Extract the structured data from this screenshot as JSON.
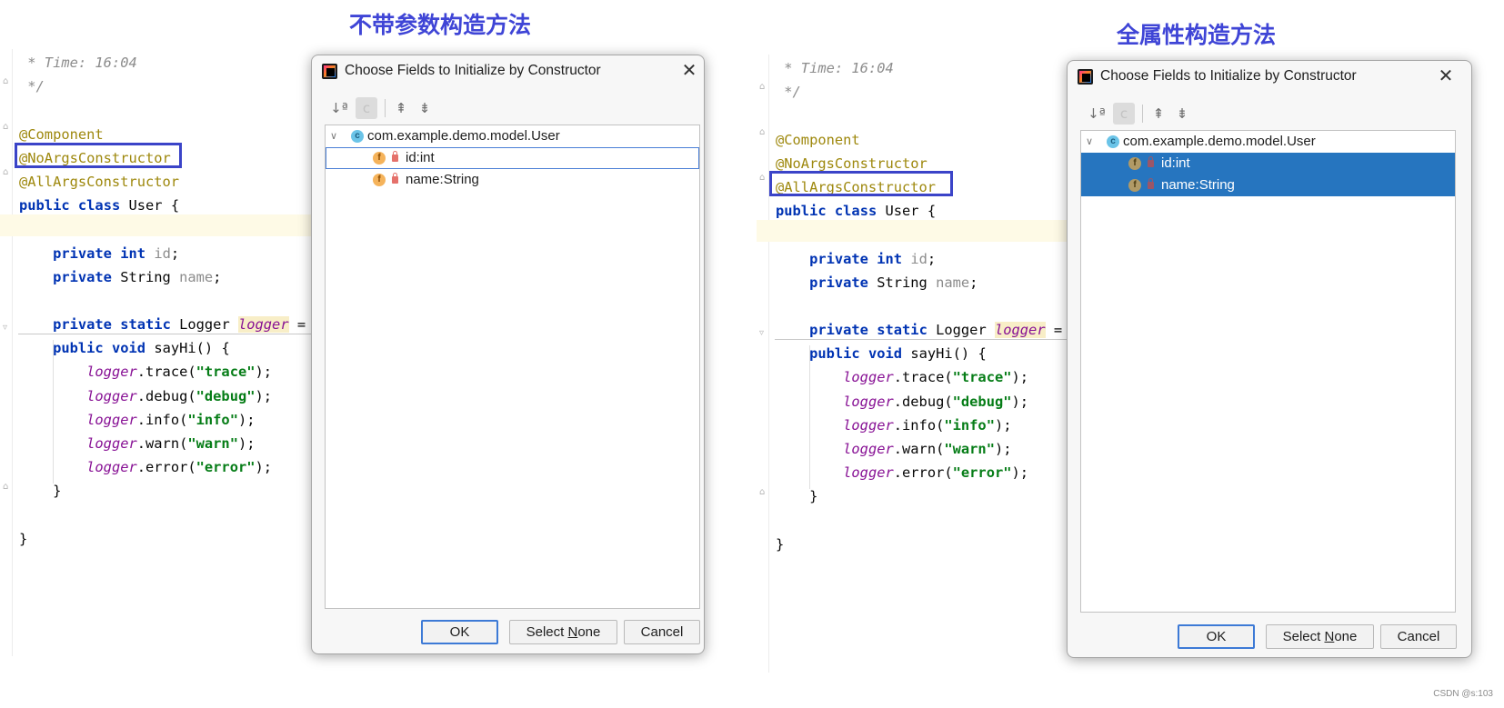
{
  "captions": {
    "left": "不带参数构造方法",
    "right": "全属性构造方法"
  },
  "code": {
    "time_comment": " * Time: 16:04",
    "comment_end": " */",
    "ann_component": "@Component",
    "ann_noargs": "@NoArgsConstructor",
    "ann_allargs": "@AllArgsConstructor",
    "kw_public": "public",
    "kw_class": "class",
    "kw_private": "private",
    "kw_int": "int",
    "kw_static": "static",
    "kw_void": "void",
    "class_decl_rest": " User {",
    "type_string": " String ",
    "field_id": "id",
    "field_name": "name",
    "semicolon": ";",
    "logger_decl_type": " Logger ",
    "logger_var": "logger",
    "logger_eq": " =",
    "say_hi": " sayHi() {",
    "call_trace": ".trace(",
    "call_debug": ".debug(",
    "call_info": ".info(",
    "call_warn": ".warn(",
    "call_error": ".error(",
    "str_trace": "\"trace\"",
    "str_debug": "\"debug\"",
    "str_info": "\"info\"",
    "str_warn": "\"warn\"",
    "str_error": "\"error\"",
    "call_end": ");",
    "close_method": "}",
    "close_class": "}"
  },
  "dialog": {
    "title": "Choose Fields to Initialize by Constructor",
    "close_glyph": "✕",
    "toolbar": {
      "sort": "↓ª",
      "pressed": "c",
      "expand": "⇞",
      "collapse": "⇟"
    },
    "tree": {
      "class_name": "com.example.demo.model.User",
      "class_badge": "c",
      "field_badge": "f",
      "chevron": "∨",
      "fields": [
        "id:int",
        "name:String"
      ]
    },
    "buttons": {
      "ok": "OK",
      "select_pre": "Select ",
      "select_u": "N",
      "select_post": "one",
      "cancel": "Cancel"
    }
  },
  "watermark": "CSDN @s:103"
}
